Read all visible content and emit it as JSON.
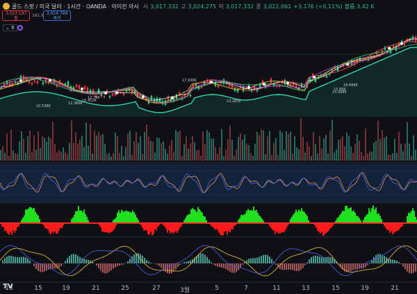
{
  "header": {
    "title": "골드 스팟 / 미국 달러 · 1시간 · OANDA · 아이진 아시",
    "open_label": "시",
    "open_value": "3,017.332",
    "high_label": "고",
    "high_value": "3,024.275",
    "low_label": "저",
    "low_value": "3,017.332",
    "close_label": "종",
    "close_value": "3,022.061",
    "change": "+3.176 (+0.11%)",
    "volume": "볼륨 3.42 K"
  },
  "trade": {
    "sell_price": "3,023.197",
    "sell_label": "팔",
    "spread": "161.6",
    "buy_price": "3,024.799",
    "buy_label": "바이",
    "indicator_count": "8"
  },
  "annotations": [
    "10.538K",
    "12.386K",
    "10.452K",
    "12.78K",
    "13.285K",
    "14.998K",
    "15.89K",
    "17.936K",
    "18.698K"
  ],
  "time_axis": [
    "13",
    "15",
    "19",
    "21",
    "25",
    "27",
    "3월",
    "5",
    "7",
    "11",
    "13",
    "15",
    "19",
    "21"
  ],
  "logo": "TV",
  "colors": {
    "background": "#0e1015",
    "up": "#22d38a",
    "down": "#e23b3b",
    "green_hist": "#1fe01f",
    "red_hist": "#ff1a1a",
    "osc_orange": "#e0874a",
    "osc_blue": "#4a5cd8",
    "macd_yellow": "#e0b030"
  }
}
